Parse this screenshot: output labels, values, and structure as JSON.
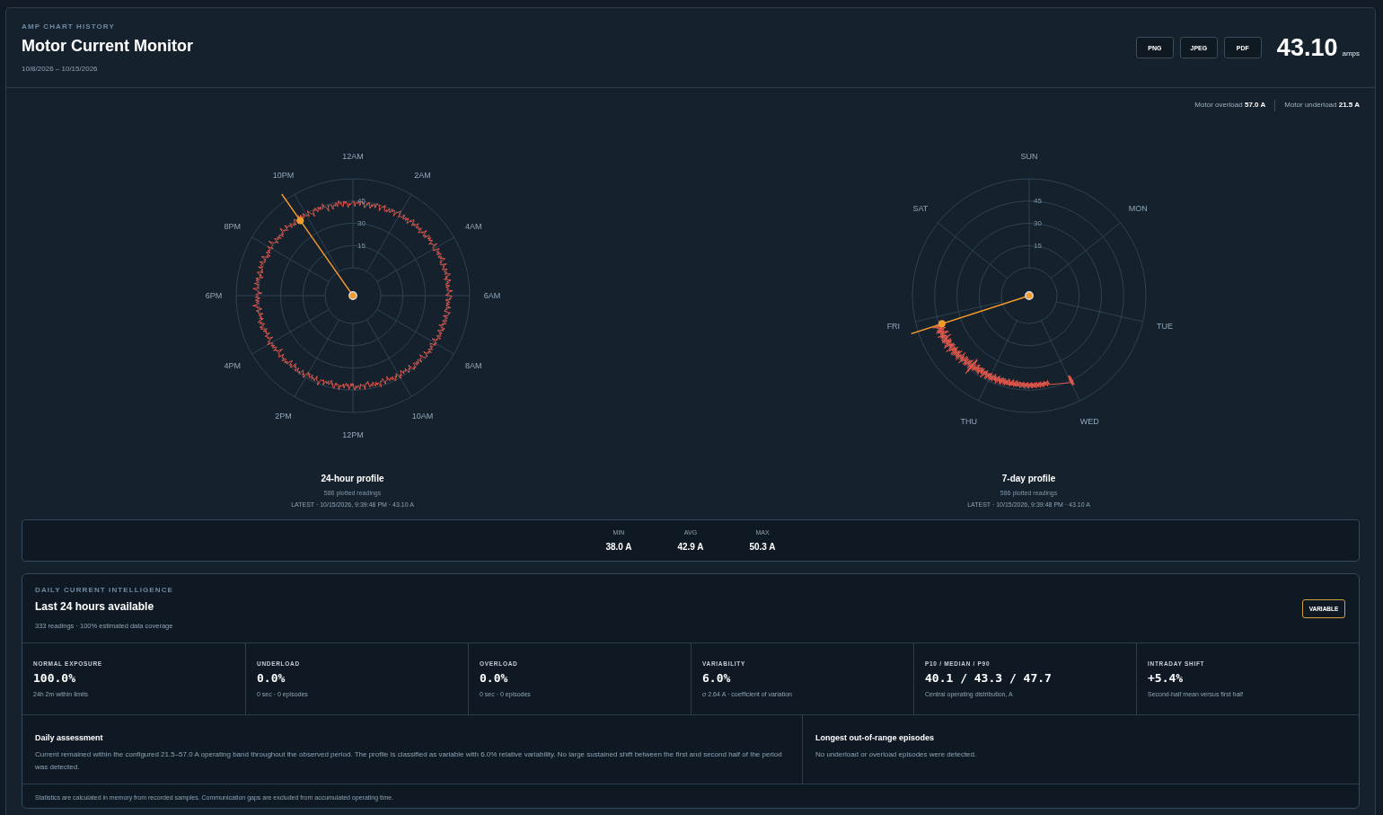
{
  "header": {
    "eyebrow": "AMP CHART HISTORY",
    "title": "Motor Current Monitor",
    "date_range": "10/8/2026 – 10/15/2026",
    "export_buttons": [
      "PNG",
      "JPEG",
      "PDF"
    ],
    "current_value": "43.10",
    "current_unit": "amps"
  },
  "thresholds": [
    "Motor overload **57.0 A**",
    "Motor underload **21.5 A**"
  ],
  "profiles": [
    {
      "kind": "day",
      "angle_labels": [
        "12AM",
        "2AM",
        "4AM",
        "6AM",
        "8AM",
        "10AM",
        "12PM",
        "2PM",
        "4PM",
        "6PM",
        "8PM",
        "10PM"
      ],
      "ring_labels": [
        "45",
        "30",
        "15"
      ],
      "title": "24-hour profile",
      "readings": "586 plotted readings",
      "latest": "LATEST · 10/15/2026, 9:39:48 PM · 43.10 A"
    },
    {
      "kind": "week",
      "angle_labels": [
        "SUN",
        "MON",
        "TUE",
        "WED",
        "THU",
        "FRI",
        "SAT"
      ],
      "ring_labels": [
        "45",
        "30",
        "15"
      ],
      "title": "7-day profile",
      "readings": "586 plotted readings",
      "latest": "LATEST · 10/15/2026, 9:39:48 PM · 43.10 A"
    }
  ],
  "summary_stats": [
    {
      "label": "MIN",
      "value": "38.0 A"
    },
    {
      "label": "AVG",
      "value": "42.9 A"
    },
    {
      "label": "MAX",
      "value": "50.3 A"
    }
  ],
  "intelligence": {
    "eyebrow": "DAILY CURRENT INTELLIGENCE",
    "title": "Last 24 hours available",
    "subtitle": "333 readings · 100% estimated data coverage",
    "badge": "VARIABLE",
    "metrics": [
      {
        "label": "NORMAL EXPOSURE",
        "value": "100.0%",
        "detail": "24h 2m within limits"
      },
      {
        "label": "UNDERLOAD",
        "value": "0.0%",
        "detail": "0 sec · 0 episodes"
      },
      {
        "label": "OVERLOAD",
        "value": "0.0%",
        "detail": "0 sec · 0 episodes"
      },
      {
        "label": "VARIABILITY",
        "value": "6.0%",
        "detail": "σ 2.64 A · coefficient of variation"
      },
      {
        "label": "P10 / MEDIAN / P90",
        "value": "40.1 / 43.3 / 47.7",
        "detail": "Central operating distribution, A"
      },
      {
        "label": "INTRADAY SHIFT",
        "value": "+5.4%",
        "detail": "Second-half mean versus first half"
      }
    ],
    "panels": [
      {
        "title": "Daily assessment",
        "text": "Current remained within the configured 21.5–57.0 A operating band throughout the observed period. The profile is classified as variable with 6.0% relative variability. No large sustained shift between the first and second half of the period was detected."
      },
      {
        "title": "Longest out-of-range episodes",
        "text": "No underload or overload episodes were detected."
      }
    ],
    "footnote": "Statistics are calculated in memory from recorded samples. Communication gaps are excluded from accumulated operating time."
  }
}
